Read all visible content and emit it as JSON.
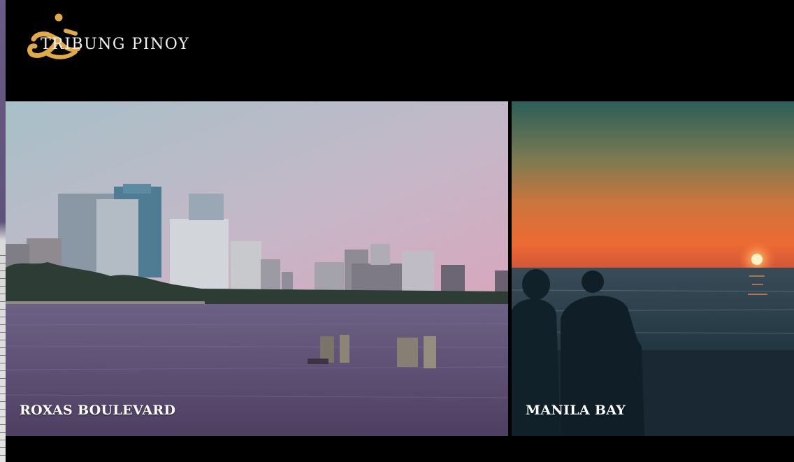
{
  "brand": {
    "name": "TRIBUNG PINOY",
    "logo_icon": "baybayin-ta-icon",
    "logo_color": "#e0a94b"
  },
  "tiles": [
    {
      "caption": "ROXAS BOULEVARD",
      "image": "manila-skyline-over-water"
    },
    {
      "caption": "MANILA BAY",
      "image": "couple-watching-sunset"
    }
  ],
  "colors": {
    "background": "#000000",
    "caption_text": "#ffffff"
  }
}
